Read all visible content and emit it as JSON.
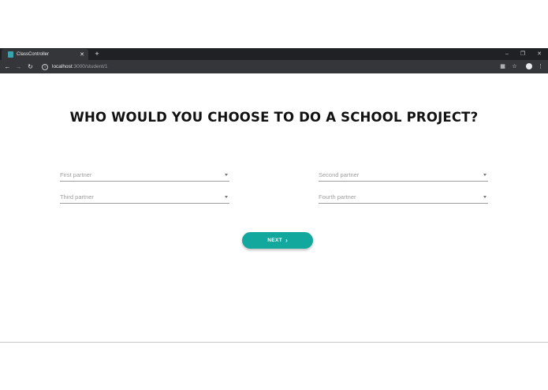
{
  "browser": {
    "tab_title": "ClassController",
    "tab_close": "✕",
    "new_tab": "+",
    "url_host": "localhost",
    "url_path": ":3000/student/1",
    "colors": {
      "tabbar": "#202124",
      "toolbar": "#35363a"
    }
  },
  "page": {
    "heading": "WHO WOULD YOU CHOOSE TO DO A SCHOOL PROJECT?",
    "fields": {
      "first": {
        "placeholder": "First partner"
      },
      "second": {
        "placeholder": "Second partner"
      },
      "third": {
        "placeholder": "Third partner"
      },
      "fourth": {
        "placeholder": "Fourth partner"
      }
    },
    "next_button": {
      "label": "NEXT",
      "color": "#13a89e"
    }
  }
}
